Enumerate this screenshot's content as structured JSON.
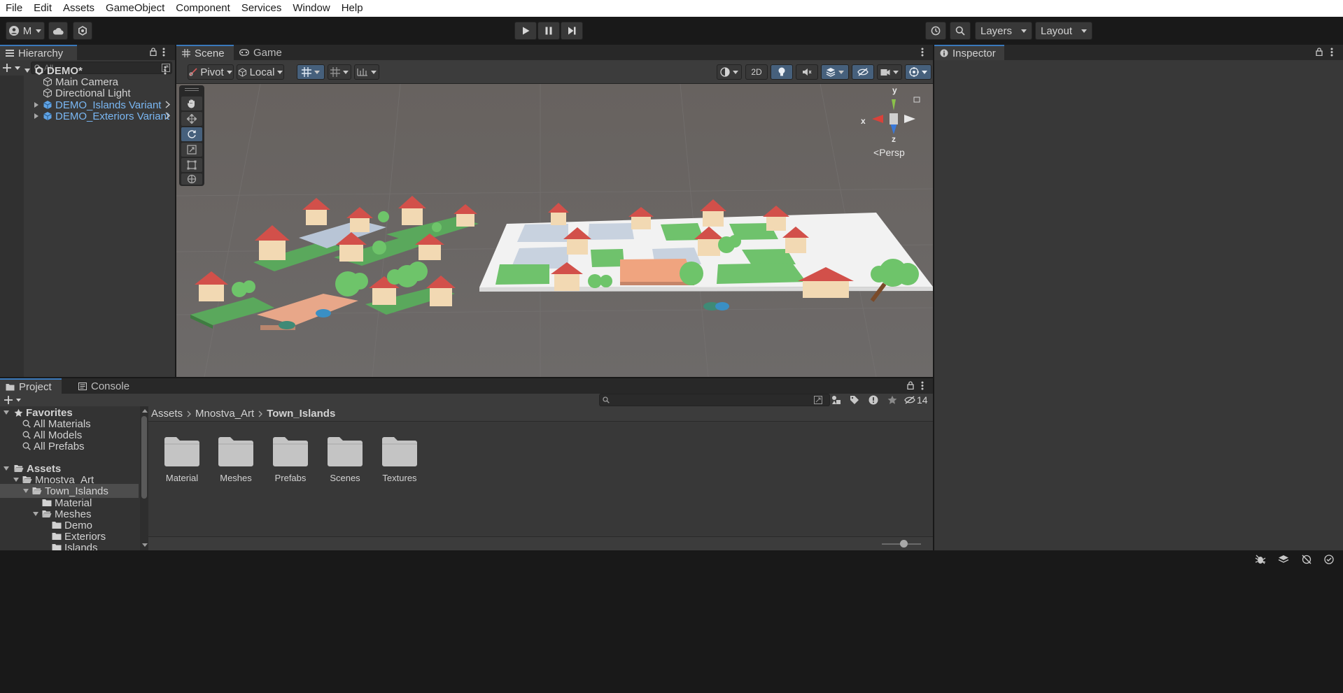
{
  "menu": [
    "File",
    "Edit",
    "Assets",
    "GameObject",
    "Component",
    "Services",
    "Window",
    "Help"
  ],
  "toolbar": {
    "account_label": "M",
    "layers_label": "Layers",
    "layout_label": "Layout"
  },
  "hierarchy": {
    "tab_label": "Hierarchy",
    "search_placeholder": "All",
    "root": "DEMO*",
    "items": [
      {
        "label": "Main Camera"
      },
      {
        "label": "Directional Light"
      },
      {
        "label": "DEMO_Islands Variant"
      },
      {
        "label": "DEMO_Exteriors Variant"
      }
    ]
  },
  "scene": {
    "tabs": [
      "Scene",
      "Game"
    ],
    "pivot_label": "Pivot",
    "local_label": "Local",
    "twod_label": "2D",
    "gizmo": {
      "y": "y",
      "x": "x",
      "z": "z",
      "persp": "Persp"
    }
  },
  "inspector": {
    "tab_label": "Inspector"
  },
  "project": {
    "tabs": [
      "Project",
      "Console"
    ],
    "hidden_count": "14",
    "breadcrumb": [
      "Assets",
      "Mnostva_Art",
      "Town_Islands"
    ],
    "favorites": {
      "title": "Favorites",
      "items": [
        "All Materials",
        "All Models",
        "All Prefabs"
      ]
    },
    "assets_tree": {
      "title": "Assets",
      "items": [
        "Mnostva_Art",
        "Town_Islands",
        "Material",
        "Meshes",
        "Demo",
        "Exteriors",
        "Islands"
      ]
    },
    "folders": [
      "Material",
      "Meshes",
      "Prefabs",
      "Scenes",
      "Textures"
    ]
  },
  "colors": {
    "accent": "#3a79bb",
    "prefab_blue": "#7ab7f3",
    "panel": "#383838",
    "viewport_bg": "#6b6867"
  }
}
